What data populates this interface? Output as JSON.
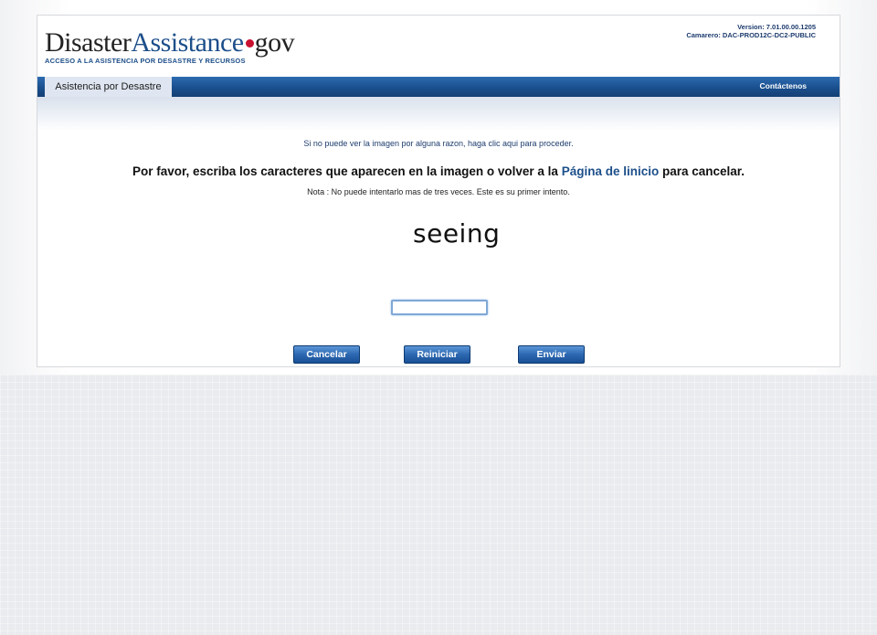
{
  "header": {
    "logo_part1": "Disaster",
    "logo_part2": "Assistance",
    "logo_part3": "gov",
    "tagline": "ACCESO A LA ASISTENCIA POR DESASTRE Y RECURSOS",
    "version": "Version: 7.01.00.00.1205",
    "server": "Camarero: DAC-PROD12C-DC2-PUBLIC"
  },
  "nav": {
    "tab_label": "Asistencia por Desastre",
    "contact_label": "Contáctenos"
  },
  "content": {
    "proceed_link": "Si no puede ver la imagen por alguna razon, haga clic aqui para proceder.",
    "instruction_pre": "Por favor, escriba los caracteres que aparecen en la imagen o volver a la ",
    "instruction_link": "Página de linicio",
    "instruction_post": " para cancelar.",
    "note": "Nota : No puede intentarlo mas de tres veces. Este es su primer intento.",
    "captcha_text": "seeing",
    "captcha_input_value": ""
  },
  "buttons": {
    "cancel": "Cancelar",
    "reset": "Reiniciar",
    "submit": "Enviar"
  },
  "colors": {
    "brand_blue": "#1d4f8a",
    "accent_red": "#c8102e",
    "nav_blue": "#1a4f8e"
  }
}
